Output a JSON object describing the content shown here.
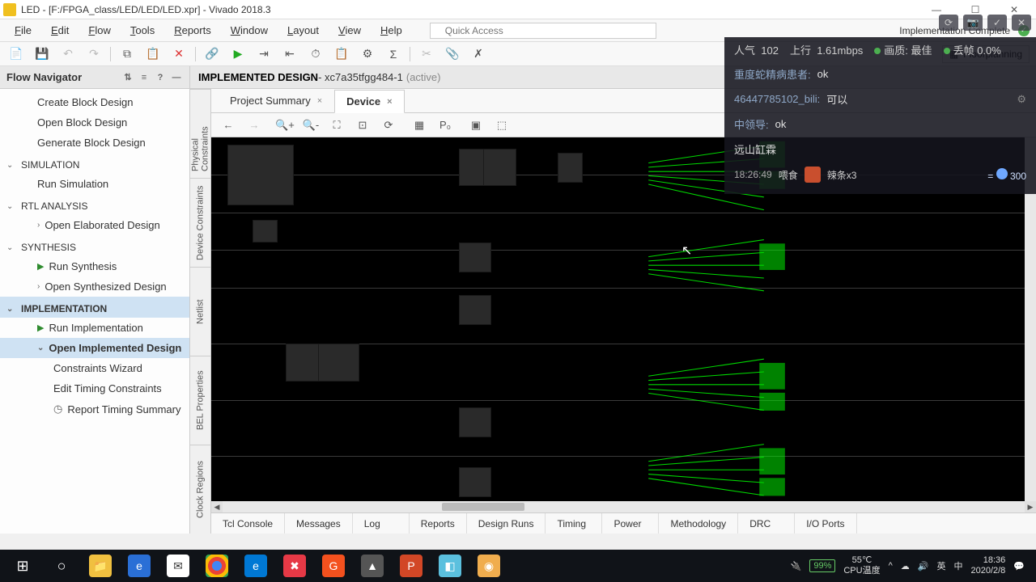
{
  "window": {
    "title": "LED - [F:/FPGA_class/LED/LED/LED.xpr] - Vivado 2018.3",
    "minimize": "—",
    "maximize": "☐",
    "close": "✕"
  },
  "menu": {
    "items": [
      "File",
      "Edit",
      "Flow",
      "Tools",
      "Reports",
      "Window",
      "Layout",
      "View",
      "Help"
    ],
    "quick_placeholder": "Quick Access",
    "impl_status": "Implementation Complete"
  },
  "layout_dropdown": "Floorplanning",
  "flow_navigator": {
    "title": "Flow Navigator",
    "items_top": [
      "Create Block Design",
      "Open Block Design",
      "Generate Block Design"
    ],
    "sections": [
      {
        "name": "SIMULATION",
        "children": [
          {
            "label": "Run Simulation",
            "type": "plain"
          }
        ]
      },
      {
        "name": "RTL ANALYSIS",
        "children": [
          {
            "label": "Open Elaborated Design",
            "type": "expand"
          }
        ]
      },
      {
        "name": "SYNTHESIS",
        "children": [
          {
            "label": "Run Synthesis",
            "type": "run"
          },
          {
            "label": "Open Synthesized Design",
            "type": "expand"
          }
        ]
      },
      {
        "name": "IMPLEMENTATION",
        "selected": true,
        "children": [
          {
            "label": "Run Implementation",
            "type": "run"
          },
          {
            "label": "Open Implemented Design",
            "type": "expand",
            "selected": true
          },
          {
            "label": "Constraints Wizard",
            "type": "plain",
            "indent": true
          },
          {
            "label": "Edit Timing Constraints",
            "type": "plain",
            "indent": true
          },
          {
            "label": "Report Timing Summary",
            "type": "clock",
            "indent": true
          }
        ]
      }
    ]
  },
  "vtabs": [
    "Physical Constraints",
    "Device Constraints",
    "Netlist",
    "BEL Properties",
    "Clock Regions"
  ],
  "impl_header": {
    "label": "IMPLEMENTED DESIGN",
    "part": " - xc7a35tfgg484-1",
    "active": "(active)"
  },
  "center_tabs": [
    {
      "label": "Project Summary",
      "active": false
    },
    {
      "label": "Device",
      "active": true
    }
  ],
  "bottom_tabs": [
    "Tcl Console",
    "Messages",
    "Log",
    "Reports",
    "Design Runs",
    "Timing",
    "Power",
    "Methodology",
    "DRC",
    "I/O Ports"
  ],
  "overlay": {
    "stats": {
      "pop_lbl": "人气",
      "pop": "102",
      "up_lbl": "上行",
      "up": "1.61mbps",
      "qual_lbl": "画质:",
      "qual": "最佳",
      "drop_lbl": "丢帧",
      "drop": "0.0%"
    },
    "rows": [
      {
        "user": "重度蛇精病患者:",
        "msg": "ok"
      },
      {
        "user": "46447785102_bili:",
        "msg": "可以"
      },
      {
        "user": "中领导:",
        "msg": "ok"
      }
    ],
    "gift_user": "远山缸霖",
    "gift": {
      "time": "18:26:49",
      "action": "喂食",
      "item": "辣条x3",
      "count": "300"
    }
  },
  "taskbar": {
    "battery": "99%",
    "temp1": "55℃",
    "temp2": "CPU温度",
    "time": "18:36",
    "date": "2020/2/8",
    "ime1": "英",
    "ime2": "中"
  }
}
